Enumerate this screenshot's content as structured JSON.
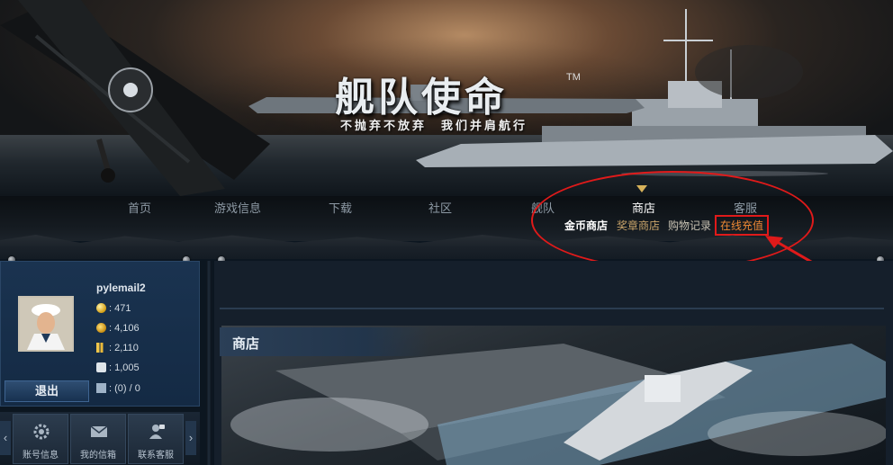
{
  "banner": {
    "logo_text": "舰队使命",
    "tm": "TM",
    "slogan": "不抛弃不放弃　我们并肩航行"
  },
  "nav": {
    "items": [
      {
        "label": "首页",
        "active": false
      },
      {
        "label": "游戏信息",
        "active": false
      },
      {
        "label": "下载",
        "active": false
      },
      {
        "label": "社区",
        "active": false
      },
      {
        "label": "舰队",
        "active": false
      },
      {
        "label": "商店",
        "active": true
      },
      {
        "label": "客服",
        "active": false
      }
    ],
    "sub_items": [
      {
        "label": "金币商店"
      },
      {
        "label": "奖章商店"
      },
      {
        "label": "购物记录"
      },
      {
        "label": "在线充值",
        "highlighted": true
      }
    ]
  },
  "user": {
    "username": "pylemail2",
    "gold": ": 471",
    "medals": ": 4,106",
    "gold_bars": ": 2,110",
    "items": ": 1,005",
    "mail": ": (0) / 0",
    "logout_label": "退出"
  },
  "quick_links": [
    {
      "label": "账号信息",
      "icon": "gear-icon"
    },
    {
      "label": "我的信箱",
      "icon": "mail-icon"
    },
    {
      "label": "联系客服",
      "icon": "support-icon"
    }
  ],
  "arrows": {
    "left": "‹",
    "right": "›"
  },
  "main": {
    "section_title": "商店"
  },
  "colors": {
    "annotation": "#e01a1a",
    "recharge_text": "#f08a35",
    "active_marker": "#d7b25a"
  }
}
